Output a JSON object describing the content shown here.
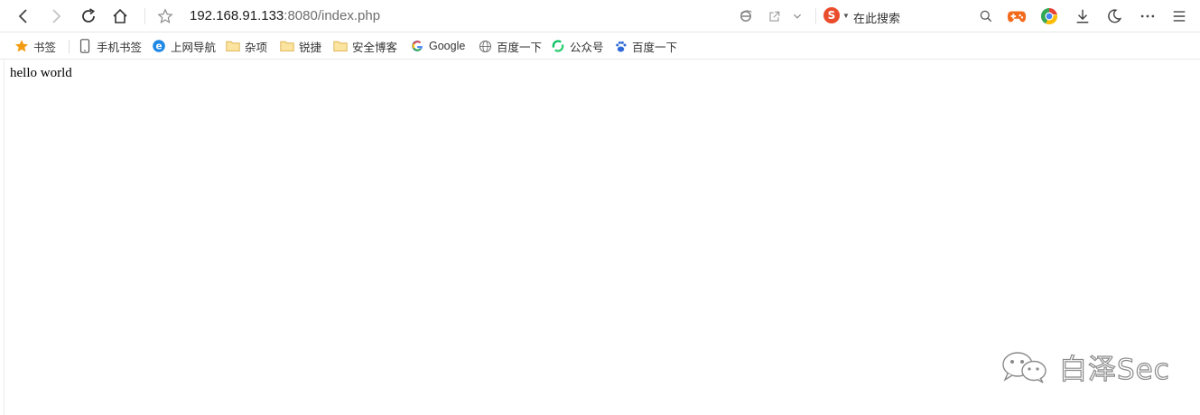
{
  "toolbar": {
    "url_host": "192.168.91.133",
    "url_rest": ":8080/index.php",
    "search_engine_glyph": "S",
    "search_placeholder": "在此搜索"
  },
  "bookmarks": {
    "items": [
      {
        "label": "书签",
        "icon": "star-icon"
      },
      {
        "label": "手机书签",
        "icon": "phone-icon"
      },
      {
        "label": "上网导航",
        "icon": "ie-icon"
      },
      {
        "label": "杂项",
        "icon": "folder-icon"
      },
      {
        "label": "锐捷",
        "icon": "folder-icon"
      },
      {
        "label": "安全博客",
        "icon": "folder-icon"
      },
      {
        "label": "Google",
        "icon": "google-icon"
      },
      {
        "label": "百度一下",
        "icon": "globe-icon"
      },
      {
        "label": "公众号",
        "icon": "green-refresh-icon"
      },
      {
        "label": "百度一下",
        "icon": "baidu-paw-icon"
      }
    ]
  },
  "page": {
    "body_text": "hello world"
  },
  "watermark": {
    "text": "白泽Sec"
  },
  "colors": {
    "star": "#f39c12",
    "folder": "#f4c95d",
    "ie": "#1e88e5",
    "engine": "#ea4d2c",
    "wechat_green": "#07c160",
    "baidu_blue": "#2e6bd8"
  }
}
